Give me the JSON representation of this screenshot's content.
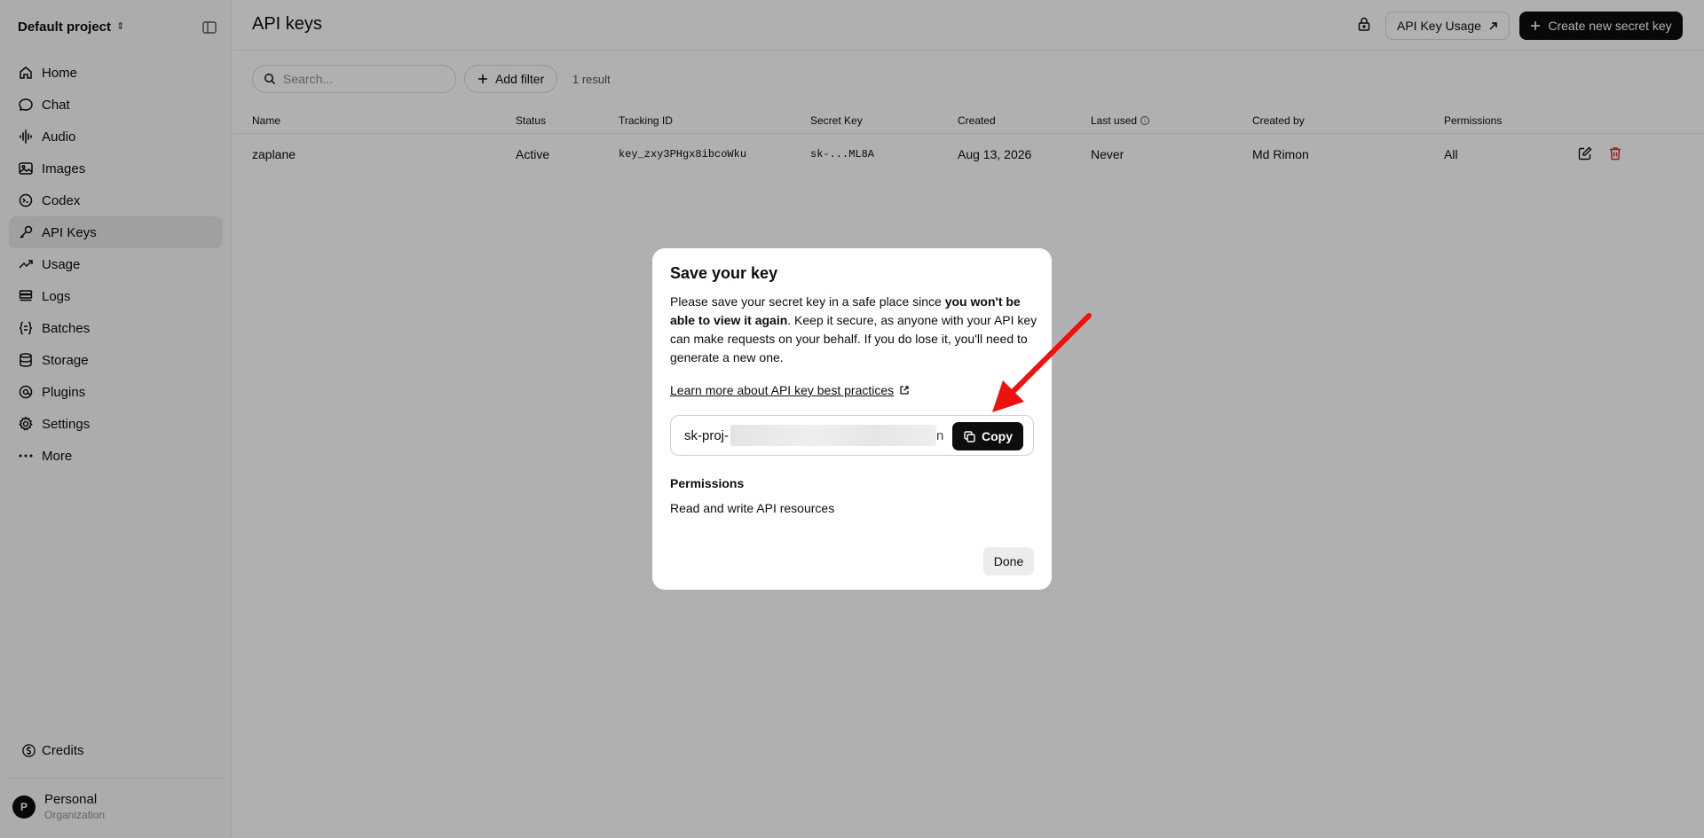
{
  "sidebar": {
    "project": "Default project",
    "items": [
      {
        "label": "Home",
        "icon": "home-icon"
      },
      {
        "label": "Chat",
        "icon": "chat-icon"
      },
      {
        "label": "Audio",
        "icon": "audio-icon"
      },
      {
        "label": "Images",
        "icon": "images-icon"
      },
      {
        "label": "Codex",
        "icon": "codex-icon"
      },
      {
        "label": "API Keys",
        "icon": "key-icon"
      },
      {
        "label": "Usage",
        "icon": "usage-icon"
      },
      {
        "label": "Logs",
        "icon": "logs-icon"
      },
      {
        "label": "Batches",
        "icon": "batches-icon"
      },
      {
        "label": "Storage",
        "icon": "storage-icon"
      },
      {
        "label": "Plugins",
        "icon": "plugins-icon"
      },
      {
        "label": "Settings",
        "icon": "settings-icon"
      },
      {
        "label": "More",
        "icon": "more-icon"
      }
    ],
    "active": "API Keys",
    "credits": "Credits",
    "org": {
      "avatar": "P",
      "name": "Personal",
      "sub": "Organization"
    }
  },
  "header": {
    "title": "API keys",
    "usage_button": "API Key Usage",
    "create_button": "Create new secret key"
  },
  "toolbar": {
    "search_placeholder": "Search...",
    "filter_button": "Add filter",
    "result_count": "1 result"
  },
  "table": {
    "columns": [
      "Name",
      "Status",
      "Tracking ID",
      "Secret Key",
      "Created",
      "Last used",
      "Created by",
      "Permissions"
    ],
    "rows": [
      {
        "name": "zaplane",
        "status": "Active",
        "tracking_id": "key_zxy3PHgx8ibcoWku",
        "secret_key": "sk-...ML8A",
        "created": "Aug 13, 2026",
        "last_used": "Never",
        "created_by": "Md Rimon",
        "permissions": "All"
      }
    ]
  },
  "modal": {
    "title": "Save your key",
    "body_pre": "Please save your secret key in a safe place since ",
    "body_bold": "you won't be able to view it again",
    "body_post": ". Keep it secure, as anyone with your API key can make requests on your behalf. If you do lose it, you'll need to generate a new one.",
    "learn_link": "Learn more about API key best practices",
    "key_prefix": "sk-proj-",
    "key_tail": "n",
    "copy_button": "Copy",
    "permissions_title": "Permissions",
    "permissions_value": "Read and write API resources",
    "done_button": "Done"
  },
  "colors": {
    "accent": "#0d0d0d",
    "danger": "#e02e2a",
    "annotation_arrow": "#ee1111"
  }
}
